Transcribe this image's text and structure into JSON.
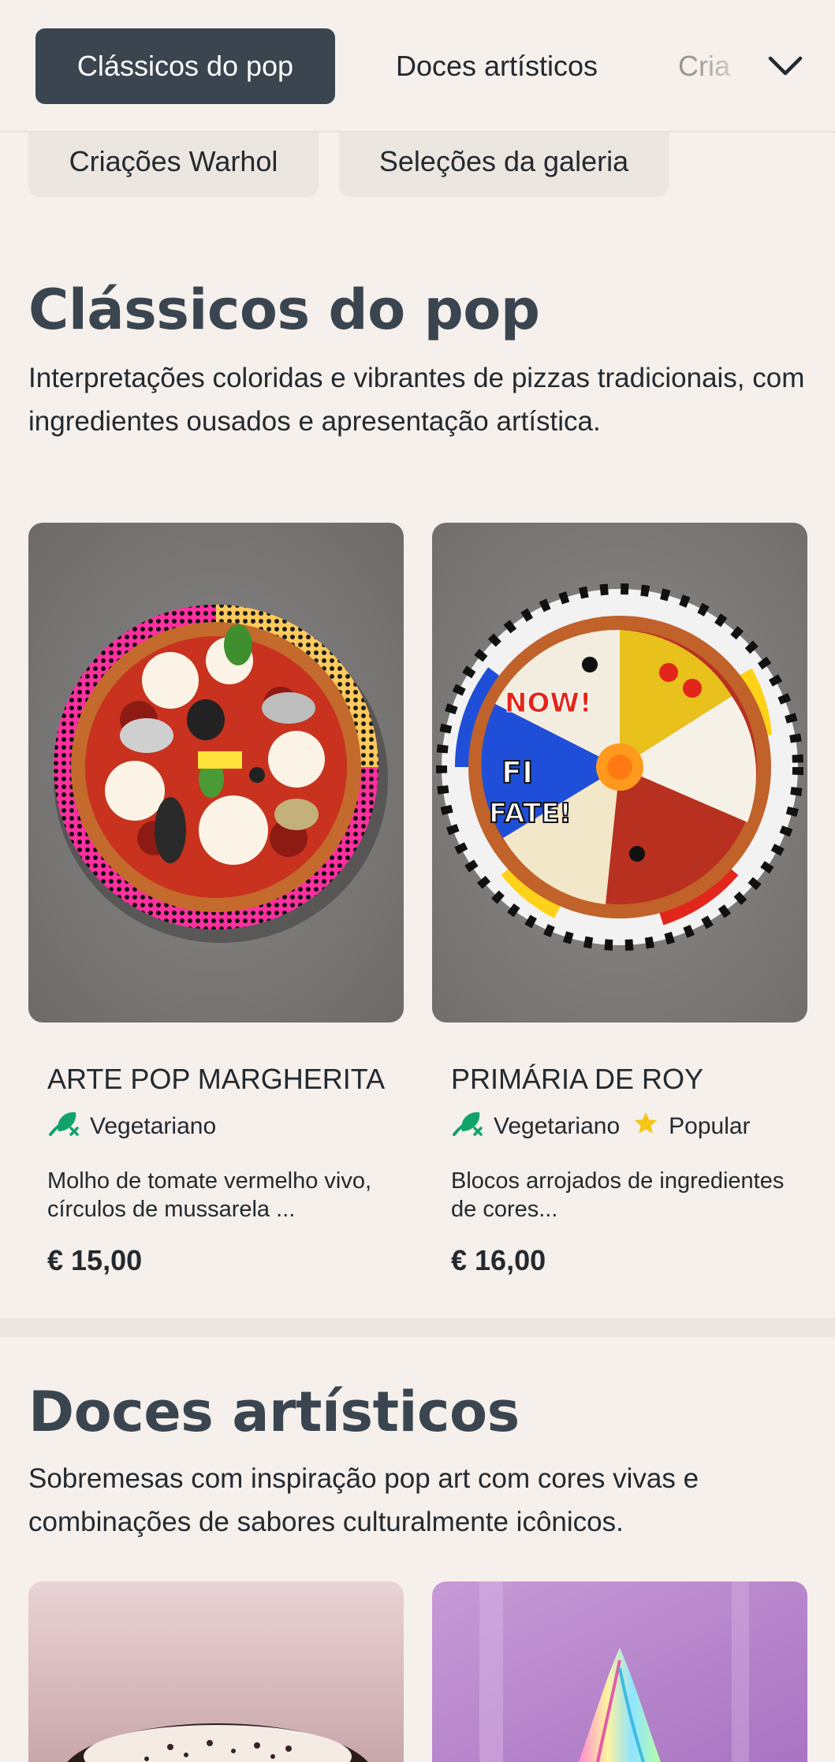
{
  "nav": {
    "tabs": [
      {
        "label": "Clássicos do pop",
        "active": true
      },
      {
        "label": "Doces artísticos",
        "active": false
      },
      {
        "label": "Cria",
        "active": false
      }
    ],
    "more_icon": "chevron-down-icon"
  },
  "chips": [
    {
      "label": "Criações Warhol"
    },
    {
      "label": "Seleções da galeria"
    }
  ],
  "sections": [
    {
      "title": "Clássicos do pop",
      "description": "Interpretações coloridas e vibrantes de pizzas tradicionais, com ingredientes ousados e apresentação artística.",
      "products": [
        {
          "name": "ARTE POP MARGHERITA",
          "tags": [
            {
              "label": "Vegetariano",
              "icon": "vegetarian-icon"
            }
          ],
          "description": "Molho de tomate vermelho vivo, círculos de mussarela ...",
          "price": "€ 15,00"
        },
        {
          "name": "PRIMÁRIA DE ROY",
          "tags": [
            {
              "label": "Vegetariano",
              "icon": "vegetarian-icon"
            },
            {
              "label": "Popular",
              "icon": "star-icon"
            }
          ],
          "description": "Blocos arrojados de ingredientes de cores...",
          "price": "€ 16,00",
          "image_text": [
            "NOW!",
            "FI",
            "FATE!"
          ]
        }
      ]
    },
    {
      "title": "Doces artísticos",
      "description": "Sobremesas com inspiração pop art com cores vivas e combinações de sabores culturalmente icônicos."
    }
  ],
  "colors": {
    "background": "#f5f0eb",
    "active_tab": "#3a4550",
    "heading": "#3a4550",
    "vegetarian_green": "#12a36b",
    "star_yellow": "#f5c518"
  }
}
